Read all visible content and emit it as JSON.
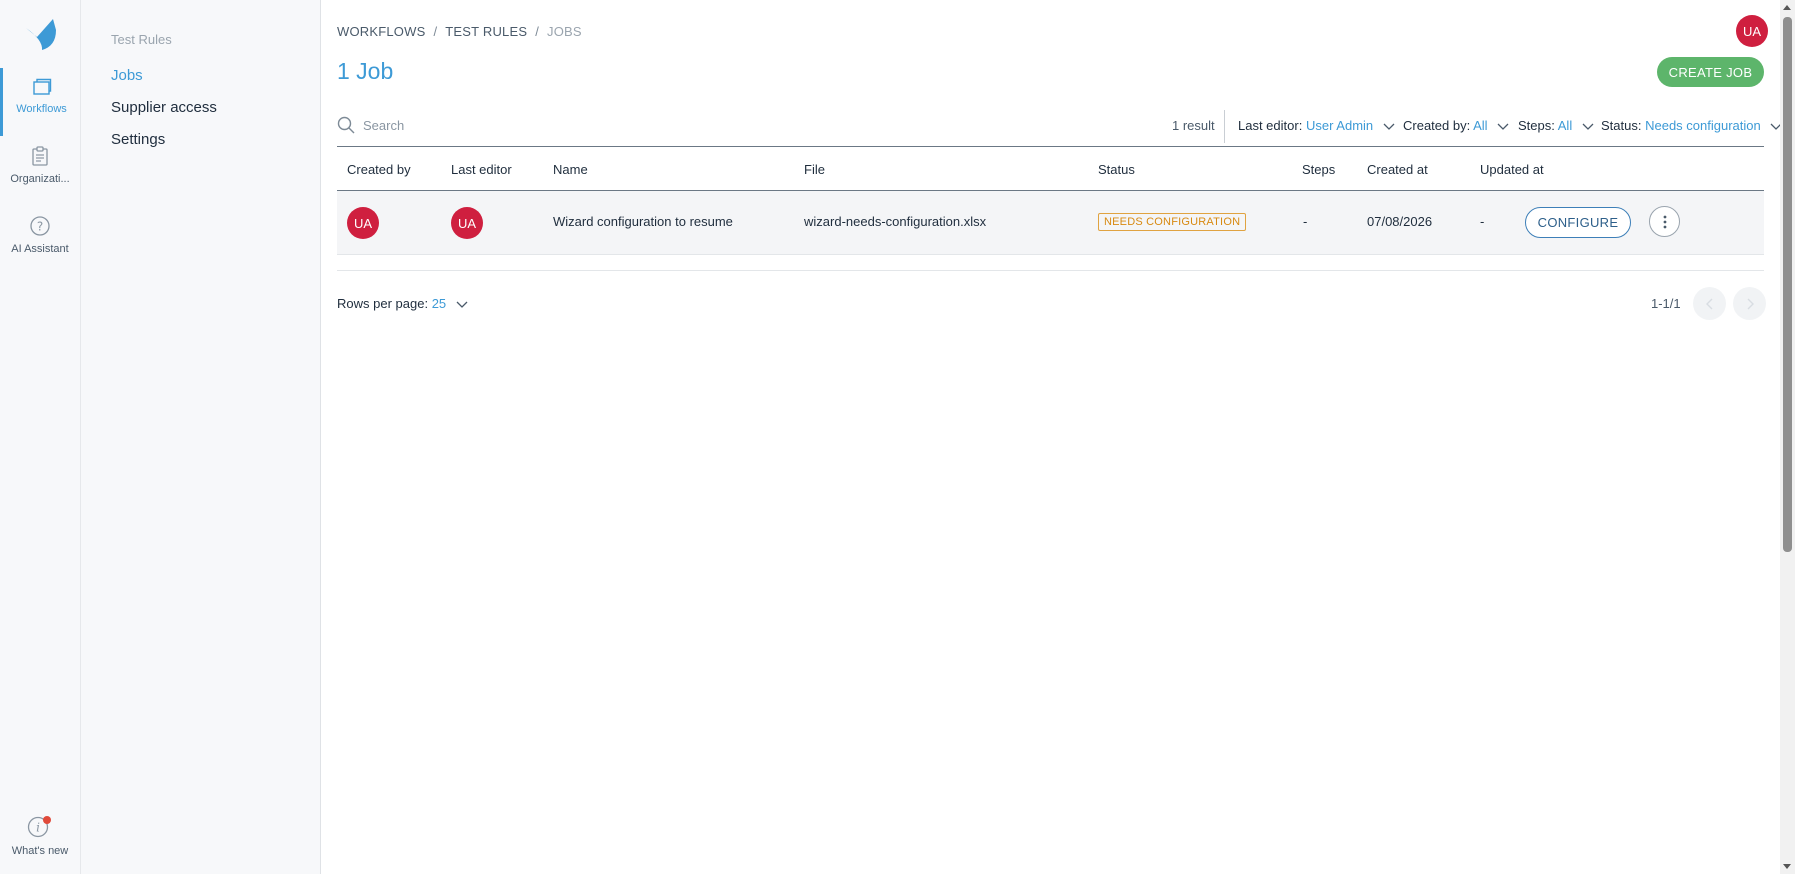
{
  "app": {
    "rail": {
      "workflows_label": "Workflows",
      "organization_label": "Organizati...",
      "ai_assistant_label": "AI Assistant",
      "whats_new_label": "What's new"
    },
    "subnav": {
      "section_title": "Test Rules",
      "items": [
        "Jobs",
        "Supplier access",
        "Settings"
      ]
    }
  },
  "header": {
    "breadcrumb": [
      "WORKFLOWS",
      "TEST RULES",
      "JOBS"
    ],
    "breadcrumb_sep": "/",
    "title": "1 Job",
    "user_initials": "UA",
    "create_label": "CREATE JOB"
  },
  "filters": {
    "search_placeholder": "Search",
    "result_count": "1 result",
    "last_editor_label": "Last editor:",
    "last_editor_value": "User Admin",
    "created_by_label": "Created by:",
    "created_by_value": "All",
    "steps_label": "Steps:",
    "steps_value": "All",
    "status_label": "Status:",
    "status_value": "Needs configuration"
  },
  "table": {
    "columns": [
      "Created by",
      "Last editor",
      "Name",
      "File",
      "Status",
      "Steps",
      "Created at",
      "Updated at"
    ],
    "rows": [
      {
        "created_by": "UA",
        "last_editor": "UA",
        "name": "Wizard configuration to resume",
        "file": "wizard-needs-configuration.xlsx",
        "status": "NEEDS CONFIGURATION",
        "steps": "-",
        "created_at": "07/08/2026",
        "updated_at": "-",
        "action_label": "CONFIGURE"
      }
    ]
  },
  "pagination": {
    "rows_per_page_label": "Rows per page:",
    "rows_per_page_value": "25",
    "range": "1-1/1"
  },
  "colors": {
    "accent": "#3d9ad6",
    "create_button": "#5db56b",
    "avatar": "#cf1f3f",
    "status_badge": "#d88a12"
  },
  "icons": [
    "logo-icon",
    "workflows-icon",
    "clipboard-icon",
    "help-circle-icon",
    "info-icon",
    "search-icon",
    "chevron-down-icon",
    "more-vertical-icon",
    "chevron-left-icon",
    "chevron-right-icon"
  ]
}
